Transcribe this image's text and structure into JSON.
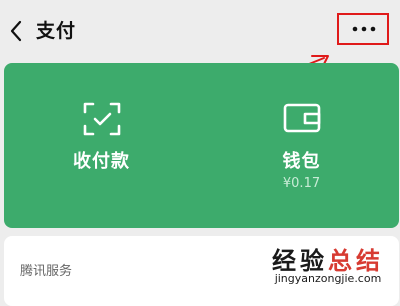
{
  "header": {
    "title": "支付",
    "back_icon": "chevron-left-icon",
    "more_icon": "more-dots-icon"
  },
  "card": {
    "pay": {
      "label": "收付款",
      "icon": "scan-check-icon"
    },
    "wallet": {
      "label": "钱包",
      "balance": "¥0.17",
      "icon": "wallet-icon"
    }
  },
  "services": {
    "title": "腾讯服务"
  },
  "watermark": {
    "main": "经验",
    "accent": "总结",
    "url": "jingyanzongjie.com"
  },
  "colors": {
    "background": "#ededed",
    "card_green": "#3dab6c",
    "highlight_red": "#e01a1a"
  }
}
